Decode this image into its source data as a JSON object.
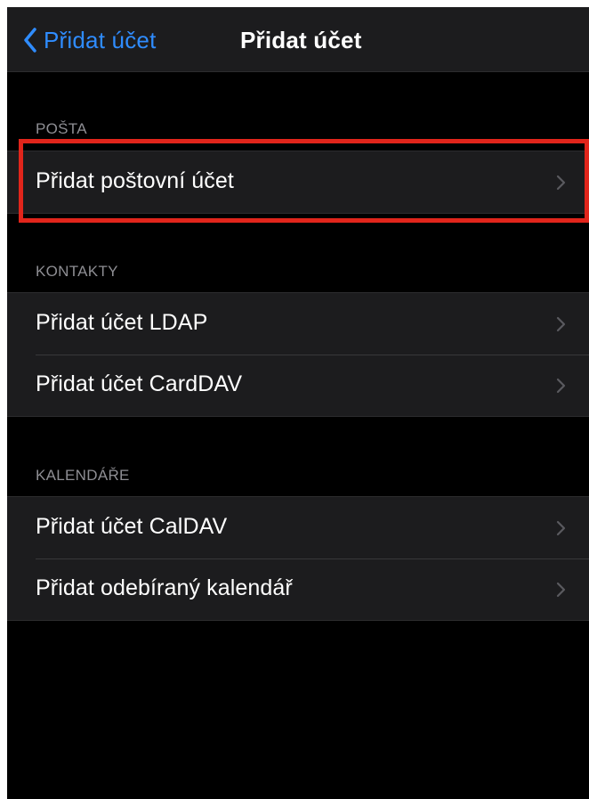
{
  "navbar": {
    "back_label": "Přidat účet",
    "title": "Přidat účet"
  },
  "sections": [
    {
      "header": "POŠTA",
      "rows": [
        {
          "label": "Přidat poštovní účet"
        }
      ]
    },
    {
      "header": "KONTAKTY",
      "rows": [
        {
          "label": "Přidat účet LDAP"
        },
        {
          "label": "Přidat účet CardDAV"
        }
      ]
    },
    {
      "header": "KALENDÁŘE",
      "rows": [
        {
          "label": "Přidat účet CalDAV"
        },
        {
          "label": "Přidat odebíraný kalendář"
        }
      ]
    }
  ],
  "colors": {
    "accent": "#2f8cff",
    "highlight": "#e1251b",
    "background": "#000000",
    "cell": "#1c1c1e",
    "secondary_text": "#8e8e93"
  },
  "icons": {
    "back": "chevron-left-icon",
    "row_disclosure": "chevron-right-icon"
  }
}
